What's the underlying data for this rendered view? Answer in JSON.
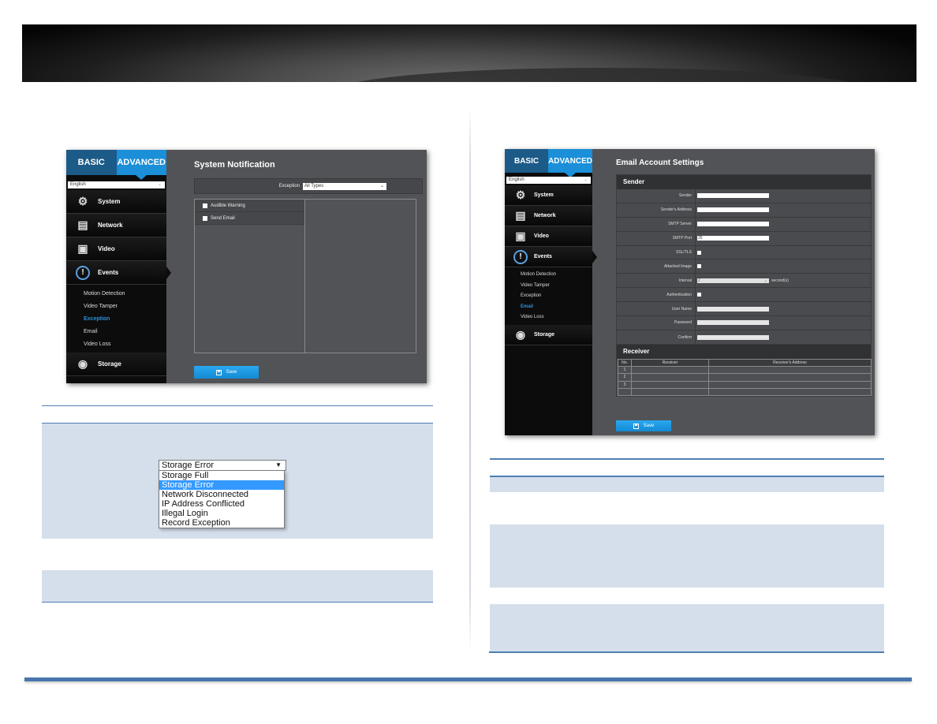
{
  "colors": {
    "accent": "#1b8fd8",
    "basic_tab": "#1c5a88",
    "doc_rule": "#4f7fb2",
    "doc_shade": "#d5dfec"
  },
  "left_ui": {
    "modes": {
      "basic": "BASIC",
      "advanced": "ADVANCED"
    },
    "language": "English",
    "nav": [
      {
        "label": "System",
        "icon": "system-user-tools-icon"
      },
      {
        "label": "Network",
        "icon": "network-tree-icon"
      },
      {
        "label": "Video",
        "icon": "video-camera-icon"
      },
      {
        "label": "Events",
        "icon": "exclamation-circle-icon"
      },
      {
        "label": "Storage",
        "icon": "storage-disk-icon"
      }
    ],
    "events_sub": [
      "Motion Detection",
      "Video Tamper",
      "Exception",
      "Email",
      "Video Loss"
    ],
    "events_sub_selected": "Exception",
    "title": "System Notification",
    "exception_label": "Exception",
    "exception_value": "All Types",
    "checkboxes": [
      {
        "label": "Audible Warning",
        "checked": false
      },
      {
        "label": "Send Email",
        "checked": false
      }
    ],
    "save_label": "Save"
  },
  "dropdown": {
    "selected": "Storage Error",
    "options": [
      "Storage Full",
      "Storage Error",
      "Network Disconnected",
      "IP Address Conflicted",
      "Illegal Login",
      "Record Exception"
    ],
    "highlighted": "Storage Error"
  },
  "right_ui": {
    "modes": {
      "basic": "BASIC",
      "advanced": "ADVANCED"
    },
    "language": "English",
    "nav": [
      {
        "label": "System"
      },
      {
        "label": "Network"
      },
      {
        "label": "Video"
      },
      {
        "label": "Events"
      },
      {
        "label": "Storage"
      }
    ],
    "events_sub": [
      "Motion Detection",
      "Video Tamper",
      "Exception",
      "Email",
      "Video Loss"
    ],
    "events_sub_selected": "Email",
    "title": "Email Account Settings",
    "sender": {
      "heading": "Sender",
      "fields": {
        "sender": {
          "label": "Sender",
          "value": ""
        },
        "sender_address": {
          "label": "Sender's Address",
          "value": ""
        },
        "smtp_server": {
          "label": "SMTP Server",
          "value": ""
        },
        "smtp_port": {
          "label": "SMTP Port",
          "value": "25"
        },
        "ssl_tls": {
          "label": "SSL/TLS",
          "checked": false
        },
        "attached_image": {
          "label": "Attached Image",
          "checked": false
        },
        "interval": {
          "label": "Interval",
          "value": "2",
          "unit": "second(s)"
        },
        "authentication": {
          "label": "Authentication",
          "checked": false
        },
        "user_name": {
          "label": "User Name",
          "value": ""
        },
        "password": {
          "label": "Password",
          "value": ""
        },
        "confirm": {
          "label": "Confirm",
          "value": ""
        }
      }
    },
    "receiver": {
      "heading": "Receiver",
      "columns": [
        "No.",
        "Receiver",
        "Receiver's Address"
      ],
      "rows": [
        {
          "no": "1",
          "receiver": "",
          "address": ""
        },
        {
          "no": "2",
          "receiver": "",
          "address": ""
        },
        {
          "no": "3",
          "receiver": "",
          "address": ""
        },
        {
          "no": "",
          "receiver": "",
          "address": ""
        }
      ]
    },
    "save_label": "Save"
  }
}
